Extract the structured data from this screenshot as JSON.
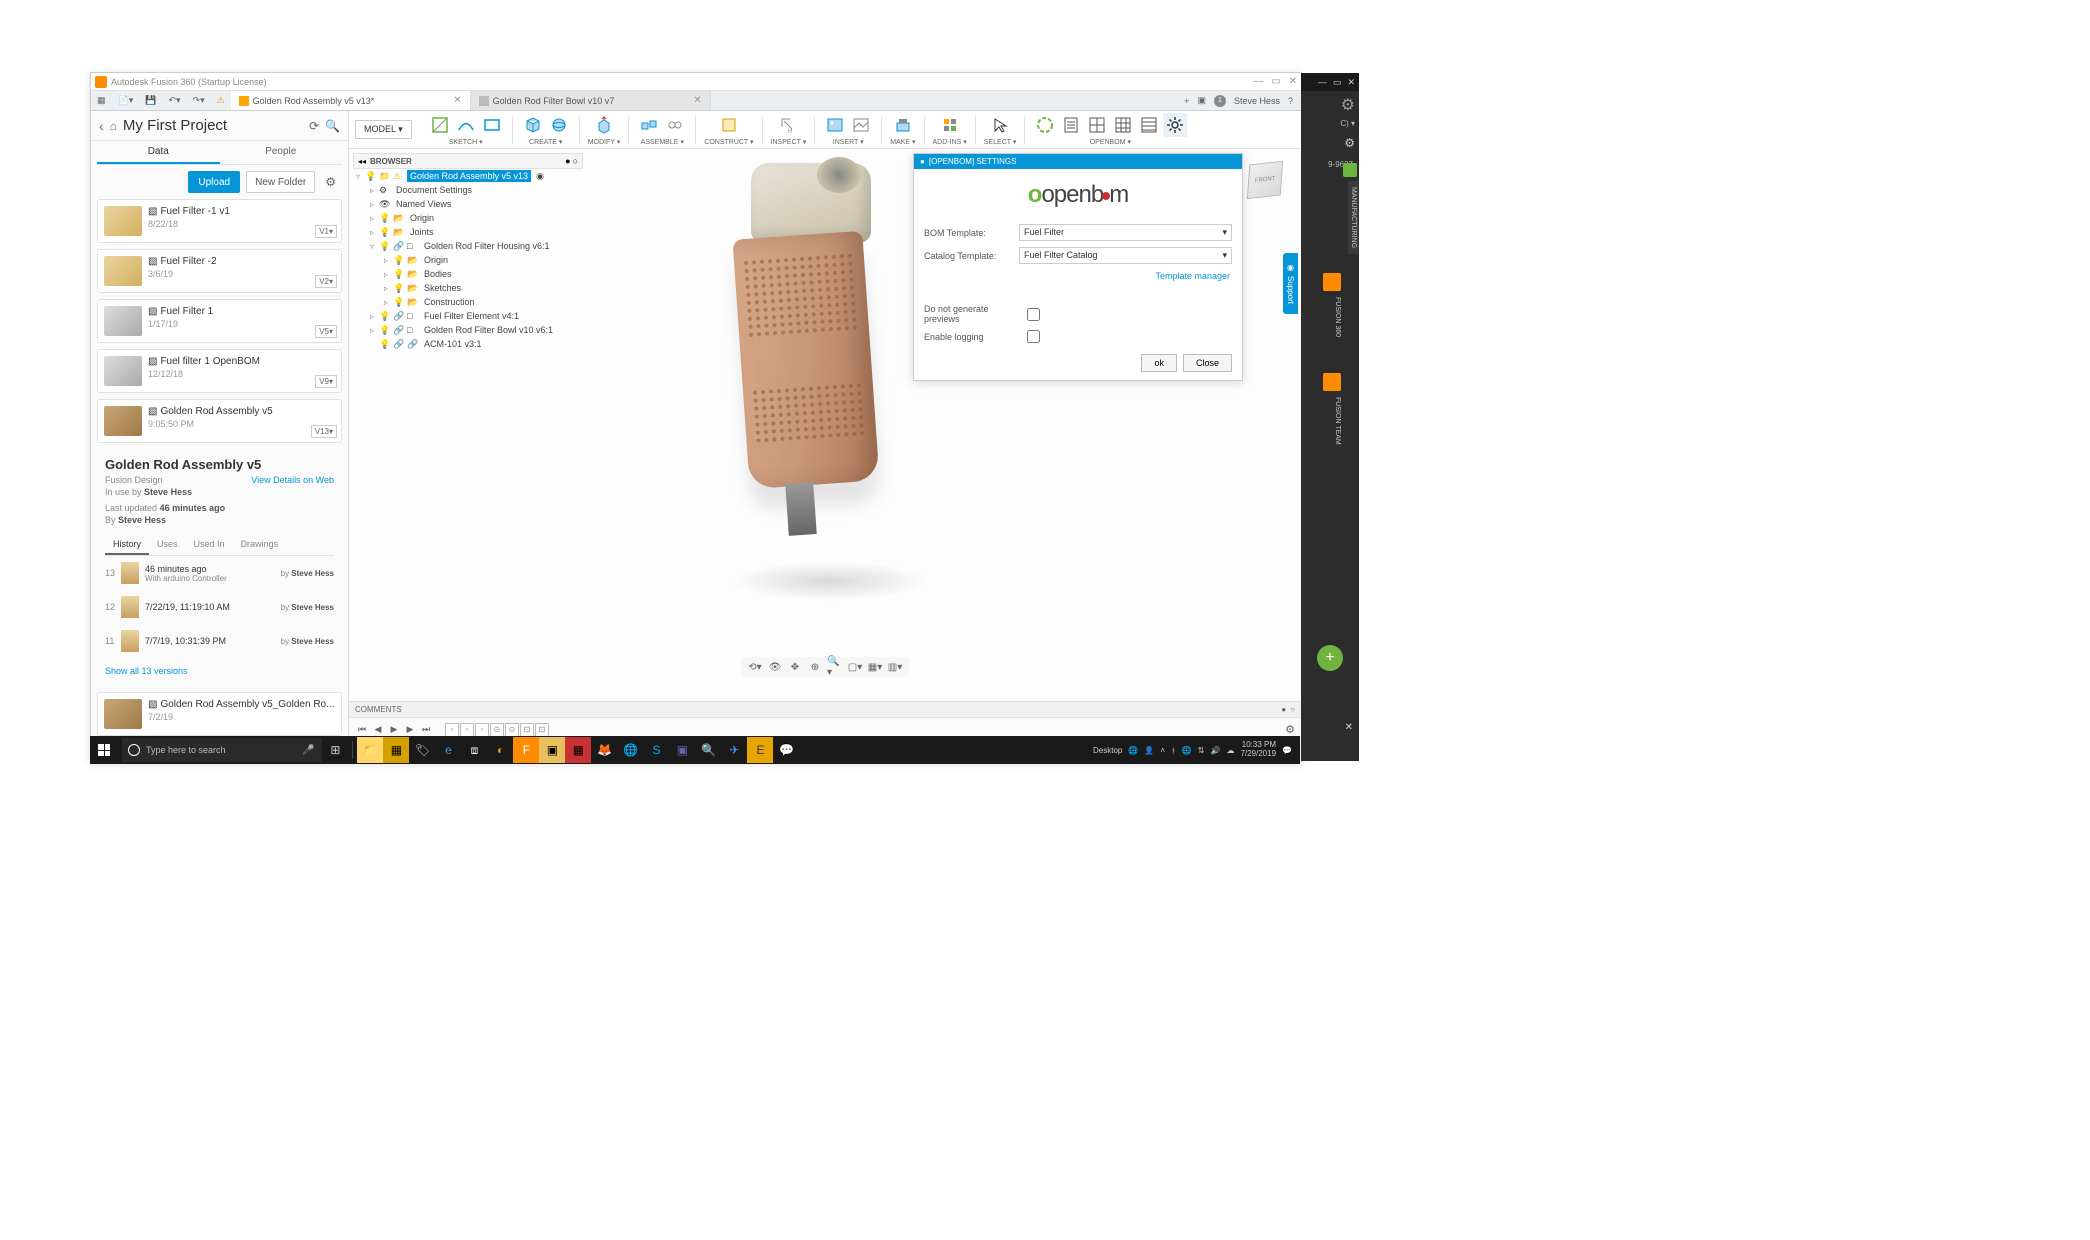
{
  "titlebar": {
    "app_title": "Autodesk Fusion 360 (Startup License)"
  },
  "data_panel": {
    "project_title": "My First Project",
    "tabs": {
      "data": "Data",
      "people": "People"
    },
    "actions": {
      "upload": "Upload",
      "new_folder": "New Folder"
    },
    "items": [
      {
        "name": "Fuel Filter -1 v1",
        "date": "8/22/18",
        "ver": "V1▾",
        "thumb": "gold"
      },
      {
        "name": "Fuel Filter -2",
        "date": "3/6/19",
        "ver": "V2▾",
        "thumb": "gold"
      },
      {
        "name": "Fuel Filter 1",
        "date": "1/17/19",
        "ver": "V5▾",
        "thumb": "gray"
      },
      {
        "name": "Fuel filter 1 OpenBOM",
        "date": "12/12/18",
        "ver": "V9▾",
        "thumb": "gray"
      },
      {
        "name": "Golden Rod Assembly v5",
        "date": "9:05:50 PM",
        "ver": "V13▾",
        "thumb": "brown"
      }
    ],
    "detail": {
      "title": "Golden Rod Assembly v5",
      "type": "Fusion Design",
      "view_link": "View Details on Web",
      "inuse_label": "In use by",
      "inuse_by": "Steve Hess",
      "updated_label": "Last updated",
      "updated_val": "46 minutes ago",
      "by_label": "By",
      "by_val": "Steve Hess"
    },
    "subtabs": {
      "history": "History",
      "uses": "Uses",
      "usedin": "Used In",
      "drawings": "Drawings"
    },
    "history": [
      {
        "num": "13",
        "time": "46 minutes ago",
        "desc": "With arduino Controller",
        "by": "Steve Hess"
      },
      {
        "num": "12",
        "time": "7/22/19, 11:19:10 AM",
        "desc": "",
        "by": "Steve Hess"
      },
      {
        "num": "11",
        "time": "7/7/19, 10:31:39 PM",
        "desc": "",
        "by": "Steve Hess"
      }
    ],
    "show_all": "Show all 13 versions",
    "extra_item": {
      "name": "Golden Rod Assembly v5_Golden Ro...",
      "date": "7/2/19"
    }
  },
  "tabs": {
    "active": "Golden Rod Assembly v5 v13*",
    "inactive": "Golden Rod Filter Bowl v10 v7",
    "user": "Steve Hess"
  },
  "toolbar": {
    "model": "MODEL ▾",
    "groups": {
      "sketch": "SKETCH ▾",
      "create": "CREATE ▾",
      "modify": "MODIFY ▾",
      "assemble": "ASSEMBLE ▾",
      "construct": "CONSTRUCT ▾",
      "inspect": "INSPECT ▾",
      "insert": "INSERT ▾",
      "make": "MAKE ▾",
      "addins": "ADD-INS ▾",
      "select": "SELECT ▾",
      "openbom": "OPENBOM ▾"
    }
  },
  "browser": {
    "label": "BROWSER",
    "root": "Golden Rod Assembly v5 v13",
    "nodes": {
      "docset": "Document Settings",
      "views": "Named Views",
      "origin": "Origin",
      "joints": "Joints",
      "housing": "Golden Rod Filter Housing v6:1",
      "h_origin": "Origin",
      "h_bodies": "Bodies",
      "h_sketches": "Sketches",
      "h_constr": "Construction",
      "element": "Fuel Filter Element v4:1",
      "bowl": "Golden Rod Filter Bowl v10 v6:1",
      "acm": "ACM-101 v3:1"
    }
  },
  "settings": {
    "panel_title": "[OPENBOM] SETTINGS",
    "logo_text": "openb",
    "logo_text2": "m",
    "bom_template_label": "BOM Template:",
    "bom_template_val": "Fuel Filter",
    "catalog_label": "Catalog Template:",
    "catalog_val": "Fuel Filter Catalog",
    "template_mgr": "Template manager",
    "no_preview": "Do not generate previews",
    "enable_log": "Enable logging",
    "ok": "ok",
    "close": "Close"
  },
  "comments": {
    "label": "COMMENTS"
  },
  "right_dock": {
    "mfg": "MANUFACTURING",
    "support": "Support",
    "f360": "FUSION 360",
    "fteam": "FUSION TEAM",
    "num": "9-9637"
  },
  "taskbar": {
    "search_placeholder": "Type here to search",
    "desktop": "Desktop",
    "time": "10:33 PM",
    "date": "7/29/2019"
  }
}
